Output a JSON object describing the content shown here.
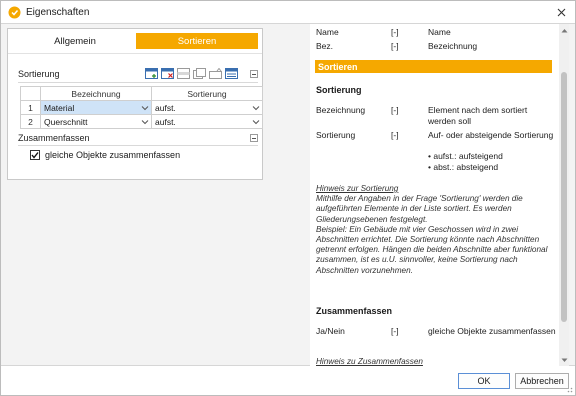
{
  "window": {
    "title": "Eigenschaften"
  },
  "tabs": [
    {
      "label": "Allgemein",
      "active": false
    },
    {
      "label": "Sortieren",
      "active": true
    }
  ],
  "sorting_group": {
    "title": "Sortierung"
  },
  "grid": {
    "columns": [
      "Bezeichnung",
      "Sortierung"
    ],
    "rows": [
      {
        "num": "1",
        "bezeichnung": "Material",
        "sortierung": "aufst."
      },
      {
        "num": "2",
        "bezeichnung": "Querschnitt",
        "sortierung": "aufst."
      }
    ]
  },
  "merge_group": {
    "title": "Zusammenfassen",
    "checkbox_label": "gleiche Objekte zusammenfassen",
    "checked": true
  },
  "help": {
    "top_rows": [
      {
        "c1": "Name",
        "c2": "[-]",
        "c3": "Name"
      },
      {
        "c1": "Bez.",
        "c2": "[-]",
        "c3": "Bezeichnung"
      }
    ],
    "section_title": "Sortieren",
    "sub1_title": "Sortierung",
    "sub1_rows": [
      {
        "c1": "Bezeichnung",
        "c2": "[-]",
        "c3": "Element nach dem sortiert werden soll"
      },
      {
        "c1": "Sortierung",
        "c2": "[-]",
        "c3": "Auf- oder absteigende Sortierung"
      },
      {
        "c3_b1": "• aufst.: aufsteigend",
        "c3_b2": "• abst.: absteigend"
      }
    ],
    "hint1_title": "Hinweis zur Sortierung",
    "hint1_text": "Mithilfe der Angaben in der Frage 'Sortierung' werden die aufgeführten Elemente in der Liste sortiert. Es werden Gliederungsebenen festgelegt.",
    "hint1_example": "Beispiel: Ein Gebäude mit vier Geschossen wird in zwei Abschnitten errichtet. Die Sortierung könnte nach Abschnitten getrennt erfolgen. Hängen die beiden Abschnitte aber funktional zusammen, ist es u.U. sinnvoller, keine Sortierung nach Abschnitten vorzunehmen.",
    "sub2_title": "Zusammenfassen",
    "sub2_row": {
      "c1": "Ja/Nein",
      "c2": "[-]",
      "c3": "gleiche Objekte zusammenfassen"
    },
    "hint2_title": "Hinweis zu Zusammenfassen"
  },
  "buttons": {
    "ok": "OK",
    "cancel": "Abbrechen"
  },
  "colors": {
    "accent": "#f5a800",
    "selection": "#cfe3f7"
  },
  "icons": [
    "app-icon",
    "close-icon",
    "add-row-icon",
    "delete-row-icon",
    "move-up-icon",
    "move-down-icon",
    "collapse-icon",
    "chevron-down-icon",
    "check-icon"
  ]
}
